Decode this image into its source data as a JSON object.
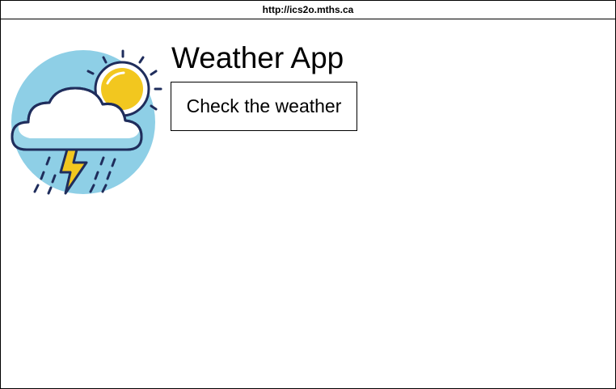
{
  "browser": {
    "url": "http://ics2o.mths.ca"
  },
  "app": {
    "title": "Weather App",
    "check_button_label": "Check the weather",
    "logo_icon": "weather-storm-icon"
  },
  "colors": {
    "sky_circle": "#8ecfe6",
    "sun": "#f2c71f",
    "outline": "#1f2d5c",
    "cloud": "#ffffff",
    "lightning": "#f2c71f"
  }
}
